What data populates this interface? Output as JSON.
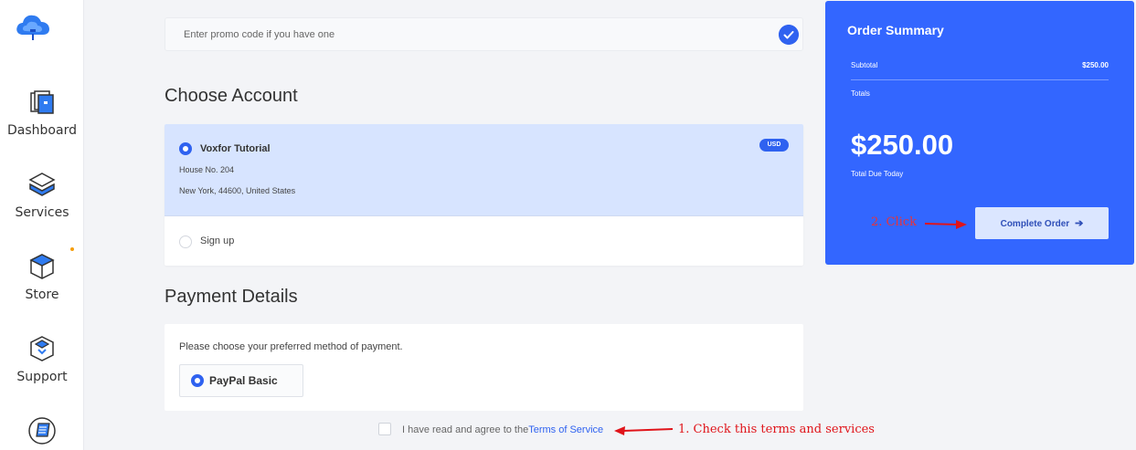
{
  "sidebar": {
    "items": [
      {
        "label": "Dashboard",
        "icon": "dashboard-icon"
      },
      {
        "label": "Services",
        "icon": "services-icon"
      },
      {
        "label": "Store",
        "icon": "store-icon"
      },
      {
        "label": "Support",
        "icon": "support-icon"
      },
      {
        "label": "",
        "icon": "billing-icon"
      }
    ]
  },
  "promo": {
    "placeholder": "Enter promo code if you have one",
    "icon": "check-icon"
  },
  "choose_account": {
    "title": "Choose Account",
    "selected": {
      "name": "Voxfor Tutorial",
      "address_line1": "House No. 204",
      "address_line2": "New York, 44600, United States",
      "currency": "USD"
    },
    "signup_label": "Sign up"
  },
  "payment": {
    "title": "Payment Details",
    "instruction": "Please choose your preferred method of payment.",
    "method": "PayPal Basic"
  },
  "terms": {
    "text": "I have read and agree to the",
    "link": "Terms of Service"
  },
  "annotations": {
    "step1": "1. Check this terms and services",
    "step2": "2. Click"
  },
  "order_summary": {
    "title": "Order Summary",
    "subtotal_label": "Subtotal",
    "subtotal_value": "$250.00",
    "totals_label": "Totals",
    "total_amount": "$250.00",
    "total_due_label": "Total Due Today",
    "button_label": "Complete Order"
  },
  "colors": {
    "primary": "#3366ff",
    "accent": "#2f62f0",
    "annotation": "#e0141a"
  }
}
